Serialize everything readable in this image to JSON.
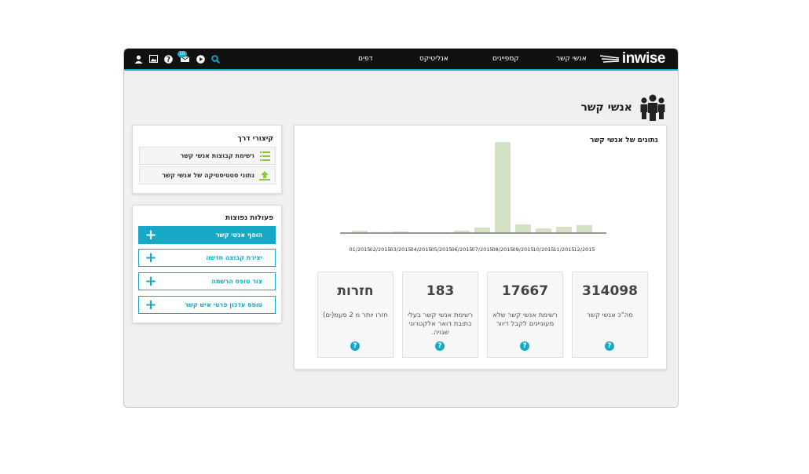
{
  "topbar": {
    "logo_text": "inwise",
    "nav": [
      "אנשי קשר",
      "קמפיינים",
      "אנליטיקס",
      "דפים"
    ],
    "icons": [
      "search-icon",
      "play-icon",
      "messages-icon",
      "help-icon",
      "image-icon",
      "user-icon"
    ],
    "messages_badge": "10",
    "accent_color": "#16a9c6"
  },
  "page": {
    "title": "אנשי קשר",
    "title_icon": "people-icon"
  },
  "shortcuts": {
    "title": "קיצורי דרך",
    "items": [
      {
        "label": "רשימת קבוצות אנשי קשר",
        "icon": "list-icon"
      },
      {
        "label": "נתוני סטטיסטיקה של אנשי קשר",
        "icon": "upload-chart-icon"
      }
    ]
  },
  "actions": {
    "title": "פעולות נפוצות",
    "items": [
      {
        "label": "הוסף אנשי קשר",
        "primary": true
      },
      {
        "label": "יצירת קבוצה חדשה",
        "primary": false
      },
      {
        "label": "צור טופס הרשמה",
        "primary": false
      },
      {
        "label": "טופס עדכון פרטי איש קשר",
        "primary": false
      }
    ]
  },
  "chart_data": {
    "type": "bar",
    "title": "נתונים של אנשי קשר",
    "categories": [
      "01/2015",
      "02/2015",
      "03/2015",
      "04/2015",
      "05/2015",
      "06/2015",
      "07/2015",
      "08/2015",
      "09/2015",
      "10/2015",
      "11/2015",
      "12/2015"
    ],
    "values": [
      2.5,
      1.2,
      1.8,
      0.4,
      0.4,
      2.7,
      6.1,
      100,
      9.5,
      5.2,
      6.9,
      8.7
    ],
    "bar_color": "#d6e2c4",
    "grid": false
  },
  "stats": [
    {
      "value": "314098",
      "label": "סה\"כ אנשי קשר"
    },
    {
      "value": "17667",
      "label": "רשימת אנשי קשר שלא מעוניינים לקבל דיוור"
    },
    {
      "value": "183",
      "label": "רשימת אנשי קשר בעלי כתובת דואר אלקטרוני שגויה."
    },
    {
      "value": "חזרות",
      "label": "חזרו יותר מ 2 פעמ(ים)"
    }
  ]
}
